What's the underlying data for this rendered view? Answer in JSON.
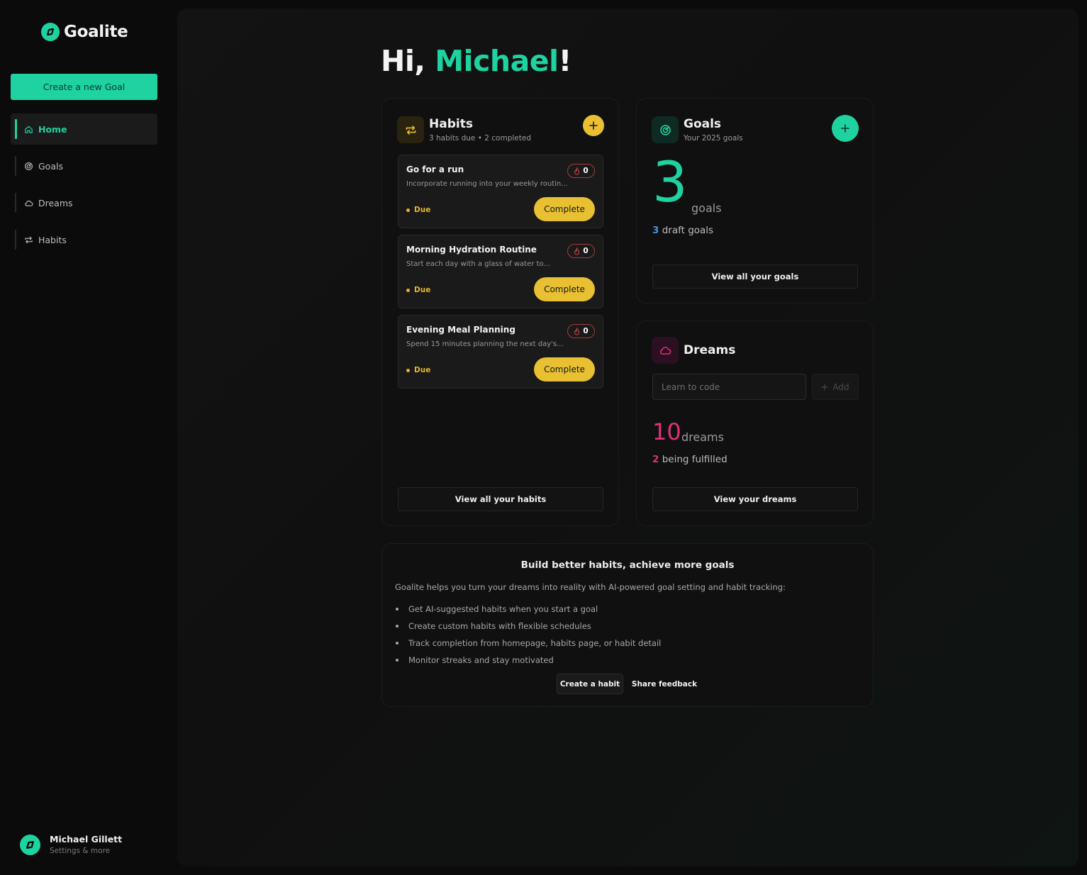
{
  "app": {
    "name": "Goalite"
  },
  "sidebar": {
    "create_goal_label": "Create a new Goal",
    "items": [
      {
        "label": "Home",
        "icon": "home-icon",
        "active": true
      },
      {
        "label": "Goals",
        "icon": "target-icon",
        "active": false
      },
      {
        "label": "Dreams",
        "icon": "cloud-icon",
        "active": false
      },
      {
        "label": "Habits",
        "icon": "repeat-icon",
        "active": false
      }
    ],
    "user": {
      "name": "Michael Gillett",
      "subtitle": "Settings & more"
    }
  },
  "greeting": {
    "prefix": "Hi, ",
    "name": "Michael",
    "suffix": "!"
  },
  "habits": {
    "title": "Habits",
    "subtitle": "3 habits due • 2 completed",
    "items": [
      {
        "name": "Go for a run",
        "description": "Incorporate running into your weekly routin...",
        "streak": "0",
        "status": "Due",
        "action": "Complete"
      },
      {
        "name": "Morning Hydration Routine",
        "description": "Start each day with a glass of water to...",
        "streak": "0",
        "status": "Due",
        "action": "Complete"
      },
      {
        "name": "Evening Meal Planning",
        "description": "Spend 15 minutes planning the next day's...",
        "streak": "0",
        "status": "Due",
        "action": "Complete"
      }
    ],
    "view_all_label": "View all your habits"
  },
  "goals": {
    "title": "Goals",
    "subtitle": "Your 2025 goals",
    "count": "3",
    "count_label": "goals",
    "draft_count": "3",
    "draft_label": "draft goals",
    "view_all_label": "View all your goals"
  },
  "dreams": {
    "title": "Dreams",
    "input_placeholder": "Learn to code",
    "add_label": "Add",
    "count": "10",
    "count_label": "dreams",
    "fulfilled_count": "2",
    "fulfilled_label": "being fulfilled",
    "view_label": "View your dreams"
  },
  "info": {
    "title": "Build better habits, achieve more goals",
    "intro": "Goalite helps you turn your dreams into reality with AI-powered goal setting and habit tracking:",
    "bullets": [
      "Get AI-suggested habits when you start a goal",
      "Create custom habits with flexible schedules",
      "Track completion from homepage, habits page, or habit detail",
      "Monitor streaks and stay motivated"
    ],
    "create_habit_label": "Create a habit",
    "feedback_label": "Share feedback"
  },
  "colors": {
    "accent": "#1ed3a0",
    "habit_yellow": "#e8c032",
    "dreams_pink": "#e0307a",
    "draft_blue": "#4a90e2"
  }
}
